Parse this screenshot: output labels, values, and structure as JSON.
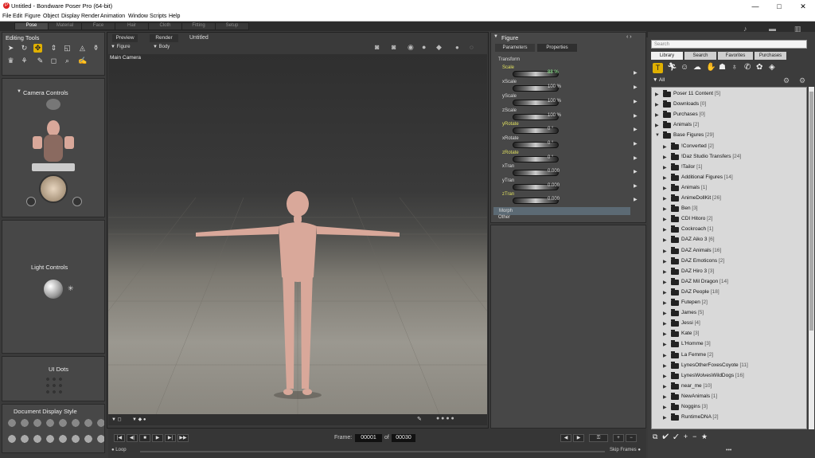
{
  "window": {
    "title": "Untitled - Bondware Poser Pro  (64-bit)",
    "minimize": "—",
    "maximize": "□",
    "close": "✕"
  },
  "menu": [
    "File",
    "Edit",
    "Figure",
    "Object",
    "Display",
    "Render",
    "Animation",
    "Window",
    "Scripts",
    "Help"
  ],
  "rooms": [
    {
      "label": "Pose",
      "active": true
    },
    {
      "label": "Material"
    },
    {
      "label": "Face"
    },
    {
      "label": "Hair"
    },
    {
      "label": "Cloth"
    },
    {
      "label": "Fitting"
    },
    {
      "label": "Setup"
    }
  ],
  "editing_tools": {
    "title": "Editing Tools"
  },
  "camera_controls": {
    "title": "Camera Controls"
  },
  "light_controls": {
    "title": "Light Controls"
  },
  "ui_dots": {
    "title": "UI Dots"
  },
  "doc_display": {
    "title": "Document Display Style"
  },
  "viewport": {
    "tabs": [
      "Preview",
      "Render"
    ],
    "doc_title": "Untitled",
    "figure_menu": "Figure",
    "body_menu": "Body",
    "camera": "Main Camera"
  },
  "figure_panel": {
    "title": "Figure",
    "tabs": [
      "Parameters",
      "Properties"
    ],
    "group": "Transform",
    "params": [
      {
        "name": "Scale",
        "value": "88 %",
        "highlight": true
      },
      {
        "name": "xScale",
        "value": "100 %"
      },
      {
        "name": "yScale",
        "value": "100 %"
      },
      {
        "name": "zScale",
        "value": "100 %"
      },
      {
        "name": "yRotate",
        "value": "0 °"
      },
      {
        "name": "xRotate",
        "value": "0 °"
      },
      {
        "name": "zRotate",
        "value": "0 °"
      },
      {
        "name": "xTran",
        "value": "0.000"
      },
      {
        "name": "yTran",
        "value": "0.000"
      },
      {
        "name": "zTran",
        "value": "0.000"
      }
    ],
    "morph": "Morph",
    "other": "Other"
  },
  "library": {
    "search_placeholder": "Search",
    "tabs": [
      "Library",
      "Search",
      "Favorites",
      "Purchases"
    ],
    "filter": "All",
    "items": [
      {
        "label": "Poser 11 Content",
        "count": "[5]",
        "level": 0,
        "open": false
      },
      {
        "label": "Downloads",
        "count": "[0]",
        "level": 0,
        "open": false
      },
      {
        "label": "Purchases",
        "count": "[0]",
        "level": 0,
        "open": false
      },
      {
        "label": "Animals",
        "count": "[2]",
        "level": 0,
        "open": false
      },
      {
        "label": "Base Figures",
        "count": "[29]",
        "level": 0,
        "open": true
      },
      {
        "label": "!Converted",
        "count": "[2]",
        "level": 1
      },
      {
        "label": "!Daz Studio Transfers",
        "count": "[24]",
        "level": 1
      },
      {
        "label": "!Tailor",
        "count": "[1]",
        "level": 1
      },
      {
        "label": "Additional Figures",
        "count": "[14]",
        "level": 1
      },
      {
        "label": "Animals",
        "count": "[1]",
        "level": 1
      },
      {
        "label": "AnimeDollKit",
        "count": "[26]",
        "level": 1
      },
      {
        "label": "Ben",
        "count": "[3]",
        "level": 1
      },
      {
        "label": "CDI Hitoro",
        "count": "[2]",
        "level": 1
      },
      {
        "label": "Cockroach",
        "count": "[1]",
        "level": 1
      },
      {
        "label": "DAZ Aiko 3",
        "count": "[6]",
        "level": 1
      },
      {
        "label": "DAZ Animals",
        "count": "[16]",
        "level": 1
      },
      {
        "label": "DAZ Emoticons",
        "count": "[2]",
        "level": 1
      },
      {
        "label": "DAZ Hiro 3",
        "count": "[3]",
        "level": 1
      },
      {
        "label": "DAZ Mil Dragon",
        "count": "[14]",
        "level": 1
      },
      {
        "label": "DAZ People",
        "count": "[18]",
        "level": 1
      },
      {
        "label": "Futepen",
        "count": "[2]",
        "level": 1
      },
      {
        "label": "James",
        "count": "[5]",
        "level": 1
      },
      {
        "label": "Jessi",
        "count": "[4]",
        "level": 1
      },
      {
        "label": "Kate",
        "count": "[3]",
        "level": 1
      },
      {
        "label": "L'Homme",
        "count": "[3]",
        "level": 1
      },
      {
        "label": "La Femme",
        "count": "[2]",
        "level": 1
      },
      {
        "label": "LynesOtherFoxesCoyote",
        "count": "[11]",
        "level": 1
      },
      {
        "label": "LynesWolvesWildDogs",
        "count": "[16]",
        "level": 1
      },
      {
        "label": "near_me",
        "count": "[10]",
        "level": 1
      },
      {
        "label": "NewAnimals",
        "count": "[1]",
        "level": 1
      },
      {
        "label": "Noggins",
        "count": "[3]",
        "level": 1
      },
      {
        "label": "RuntimeDNA",
        "count": "[2]",
        "level": 1
      }
    ]
  },
  "timeline": {
    "frame_label": "Frame:",
    "current": "00001",
    "of": "of",
    "total": "00030",
    "loop": "Loop",
    "skip": "Skip Frames"
  },
  "colors": {
    "accent": "#e0b000",
    "skin": "#d9a89a"
  }
}
